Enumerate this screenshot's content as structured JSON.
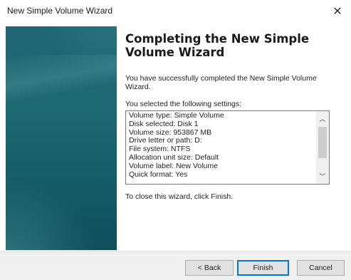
{
  "window": {
    "title": "New Simple Volume Wizard",
    "close_glyph": "✕"
  },
  "content": {
    "heading": "Completing the New Simple Volume Wizard",
    "success_text": "You have successfully completed the New Simple Volume Wizard.",
    "settings_label": "You selected the following settings:",
    "settings": [
      "Volume type: Simple Volume",
      "Disk selected: Disk 1",
      "Volume size: 953867 MB",
      "Drive letter or path: D:",
      "File system: NTFS",
      "Allocation unit size: Default",
      "Volume label: New Volume",
      "Quick format: Yes"
    ],
    "scroll_up_glyph": "︿",
    "scroll_down_glyph": "﹀",
    "close_note": "To close this wizard, click Finish."
  },
  "buttons": {
    "back": "< Back",
    "finish": "Finish",
    "cancel": "Cancel"
  },
  "colors": {
    "side_panel": "#1e6a73",
    "default_button_border": "#0078d7"
  }
}
